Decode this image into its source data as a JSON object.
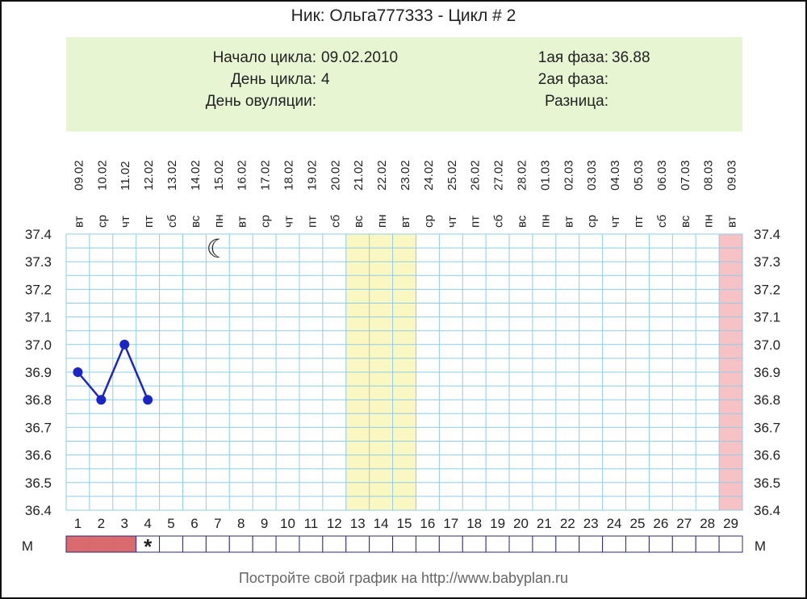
{
  "title": "Ник: Ольга777333 - Цикл # 2",
  "info": {
    "cycle_start_label": "Начало цикла:",
    "cycle_start_value": "09.02.2010",
    "cycle_day_label": "День цикла:",
    "cycle_day_value": "4",
    "ovulation_day_label": "День овуляции:",
    "ovulation_day_value": "",
    "phase1_label": "1ая фаза:",
    "phase1_value": "36.88",
    "phase2_label": "2ая фаза:",
    "phase2_value": "",
    "difference_label": "Разница:",
    "difference_value": ""
  },
  "footer": "Постройте свой график на http://www.babyplan.ru",
  "colors": {
    "grid": "#8ecde8",
    "line": "#1a25c9",
    "highlight": "#fbf7c2",
    "last_day": "#f6c2c6",
    "menses": "#d96a6d",
    "menses_box_border": "#2a2a7a",
    "star": "#c9536a"
  },
  "chart_data": {
    "type": "line",
    "dates": [
      "09.02",
      "10.02",
      "11.02",
      "12.02",
      "13.02",
      "14.02",
      "15.02",
      "16.02",
      "17.02",
      "18.02",
      "19.02",
      "20.02",
      "21.02",
      "22.02",
      "23.02",
      "24.02",
      "25.02",
      "26.02",
      "27.02",
      "28.02",
      "01.03",
      "02.03",
      "03.03",
      "04.03",
      "05.03",
      "06.03",
      "07.03",
      "08.03",
      "09.03"
    ],
    "weekdays": [
      "вт",
      "ср",
      "чт",
      "пт",
      "сб",
      "вс",
      "пн",
      "вт",
      "ср",
      "чт",
      "пт",
      "сб",
      "вс",
      "пн",
      "вт",
      "ср",
      "чт",
      "пт",
      "сб",
      "вс",
      "пн",
      "вт",
      "ср",
      "чт",
      "пт",
      "сб",
      "вс",
      "пн",
      "вт"
    ],
    "days": [
      "1",
      "2",
      "3",
      "4",
      "5",
      "6",
      "7",
      "8",
      "9",
      "10",
      "11",
      "12",
      "13",
      "14",
      "15",
      "16",
      "17",
      "18",
      "19",
      "20",
      "21",
      "22",
      "23",
      "24",
      "25",
      "26",
      "27",
      "28",
      "29"
    ],
    "y_ticks": [
      "37.4",
      "37.3",
      "37.2",
      "37.1",
      "37.0",
      "36.9",
      "36.8",
      "36.7",
      "36.6",
      "36.5",
      "36.4"
    ],
    "ylim": [
      36.4,
      37.4
    ],
    "series": [
      {
        "x": [
          1,
          2,
          3,
          4
        ],
        "values": [
          36.9,
          36.8,
          37.0,
          36.8
        ]
      }
    ],
    "highlight_days": [
      13,
      14,
      15
    ],
    "last_day": 29,
    "moon_day": 7,
    "moon_symbol": "☾",
    "menses_label": "М",
    "menses_days": [
      1,
      2,
      3
    ],
    "star_day": 4,
    "star_symbol": "*"
  }
}
